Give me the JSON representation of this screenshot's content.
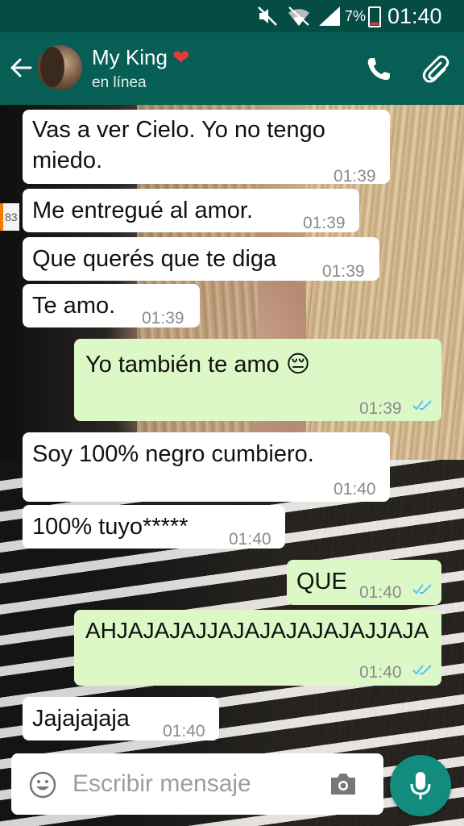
{
  "status_bar": {
    "battery": "7%",
    "time": "01:40"
  },
  "header": {
    "contact_name": "My King",
    "heart_emoji": "❤",
    "status": "en línea",
    "icons": [
      "back-arrow-icon",
      "avatar",
      "phone-icon",
      "paperclip-icon"
    ]
  },
  "unread_badge": "83",
  "messages": [
    {
      "from": "them",
      "text": "Vas a ver Cielo. Yo no tengo miedo.",
      "time": "01:39"
    },
    {
      "from": "them",
      "text": "Me entregué al amor.",
      "time": "01:39"
    },
    {
      "from": "them",
      "text": "Que querés que te diga",
      "time": "01:39"
    },
    {
      "from": "them",
      "text": "Te amo.",
      "time": "01:39"
    },
    {
      "from": "me",
      "text": "Yo también te amo",
      "emoji": "😔",
      "time": "01:39",
      "read": true
    },
    {
      "from": "them",
      "text": "Soy 100% negro cumbiero.",
      "time": "01:40"
    },
    {
      "from": "them",
      "text": "100% tuyo*****",
      "time": "01:40"
    },
    {
      "from": "me",
      "text": "QUE",
      "time": "01:40",
      "read": true
    },
    {
      "from": "me",
      "text": "AHJAJAJAJJAJAJAJAJAJAJJAJA",
      "time": "01:40",
      "read": true
    },
    {
      "from": "them",
      "text": "Jajajajaja",
      "time": "01:40"
    }
  ],
  "composer": {
    "placeholder": "Escribir mensaje"
  },
  "colors": {
    "header": "#075e54",
    "status_bar": "#054c44",
    "outgoing": "#dcf8c6",
    "incoming": "#ffffff",
    "fab": "#128c7e",
    "read_ticks": "#4fc3f7"
  }
}
